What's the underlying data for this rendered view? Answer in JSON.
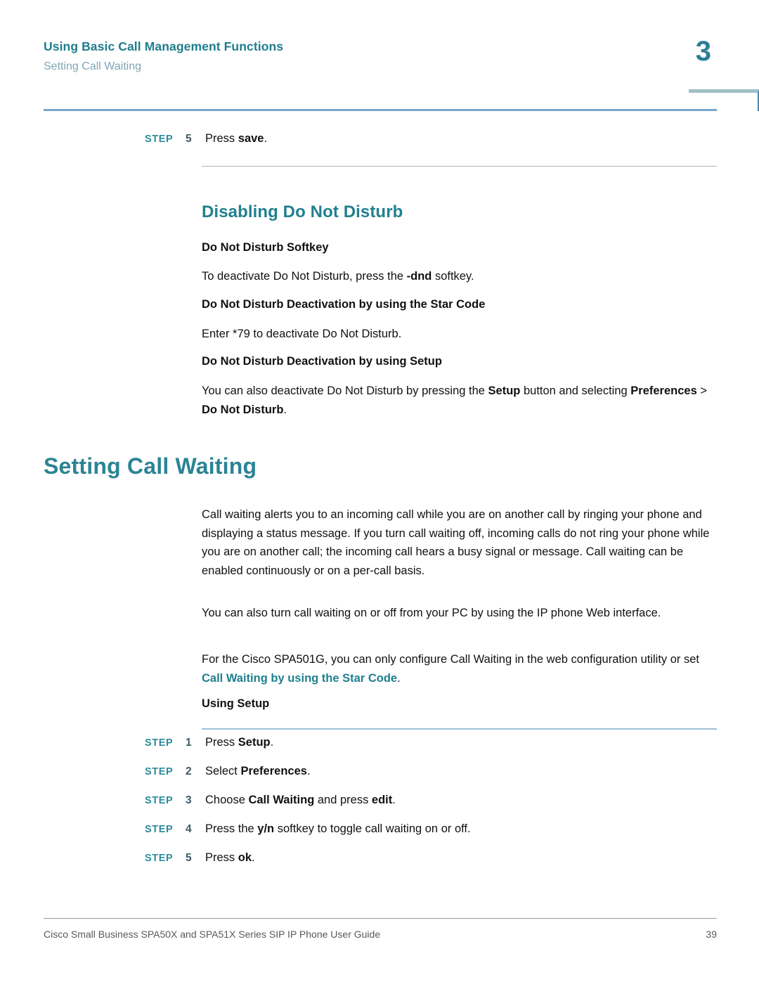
{
  "header": {
    "title": "Using Basic Call Management Functions",
    "subtitle": "Setting Call Waiting",
    "chapter_number": "3",
    "accent_color": "#1f7d8c",
    "subtitle_color": "#7fa7b4",
    "rule_color": "#7aa7cc"
  },
  "sections": {
    "top_step": {
      "label": "STEP",
      "number": "5",
      "text_before": "Press ",
      "text_bold": "save",
      "text_after": "."
    },
    "disabling_dnd": {
      "heading": "Disabling Do Not Disturb",
      "softkey_heading": "Do Not Disturb Softkey",
      "softkey_body_before": "To deactivate Do Not Disturb, press the ",
      "softkey_body_bold": "-dnd",
      "softkey_body_after": " softkey.",
      "starcode_heading": "Do Not Disturb Deactivation by using the Star Code",
      "starcode_body": "Enter *79 to deactivate Do Not Disturb.",
      "setup_heading": "Do Not Disturb Deactivation by using Setup",
      "setup_body_1": "You can also deactivate Do Not Disturb by pressing the ",
      "setup_body_bold_1": "Setup",
      "setup_body_2": " button and selecting ",
      "setup_body_bold_2": "Preferences",
      "setup_body_3": " > ",
      "setup_body_bold_3": "Do Not Disturb",
      "setup_body_4": "."
    },
    "setting_call_waiting": {
      "heading": "Setting Call Waiting",
      "paragraph_1": "Call waiting alerts you to an incoming call while you are on another call by ringing your phone and displaying a status message. If you turn call waiting off, incoming calls do not ring your phone while you are on another call; the incoming call hears a busy signal or message. Call waiting can be enabled continuously or on a per-call basis.",
      "paragraph_2": "You can also turn call waiting on or off from your PC by using the IP phone Web interface.",
      "paragraph_3_before": "For the Cisco SPA501G, you can only configure Call Waiting in the web configuration utility or set ",
      "paragraph_3_xref": "Call Waiting by using the Star Code",
      "paragraph_3_after": ".",
      "xref_color": "#1f808f",
      "using_setup_heading": "Using Setup",
      "steps": [
        {
          "label": "STEP",
          "number": "1",
          "before": "Press ",
          "bold": "Setup",
          "after": "."
        },
        {
          "label": "STEP",
          "number": "2",
          "before": "Select ",
          "bold": "Preferences",
          "after": "."
        },
        {
          "label": "STEP",
          "number": "3",
          "before": "Choose ",
          "bold": "Call Waiting",
          "mid": " and press ",
          "bold2": "edit",
          "after": "."
        },
        {
          "label": "STEP",
          "number": "4",
          "before": "Press the ",
          "bold": "y/n",
          "after": " softkey to toggle call waiting on or off."
        },
        {
          "label": "STEP",
          "number": "5",
          "before": "Press ",
          "bold": "ok",
          "after": "."
        }
      ]
    }
  },
  "footer": {
    "text": "Cisco Small Business SPA50X and SPA51X Series SIP IP Phone User Guide",
    "page_number": "39"
  }
}
